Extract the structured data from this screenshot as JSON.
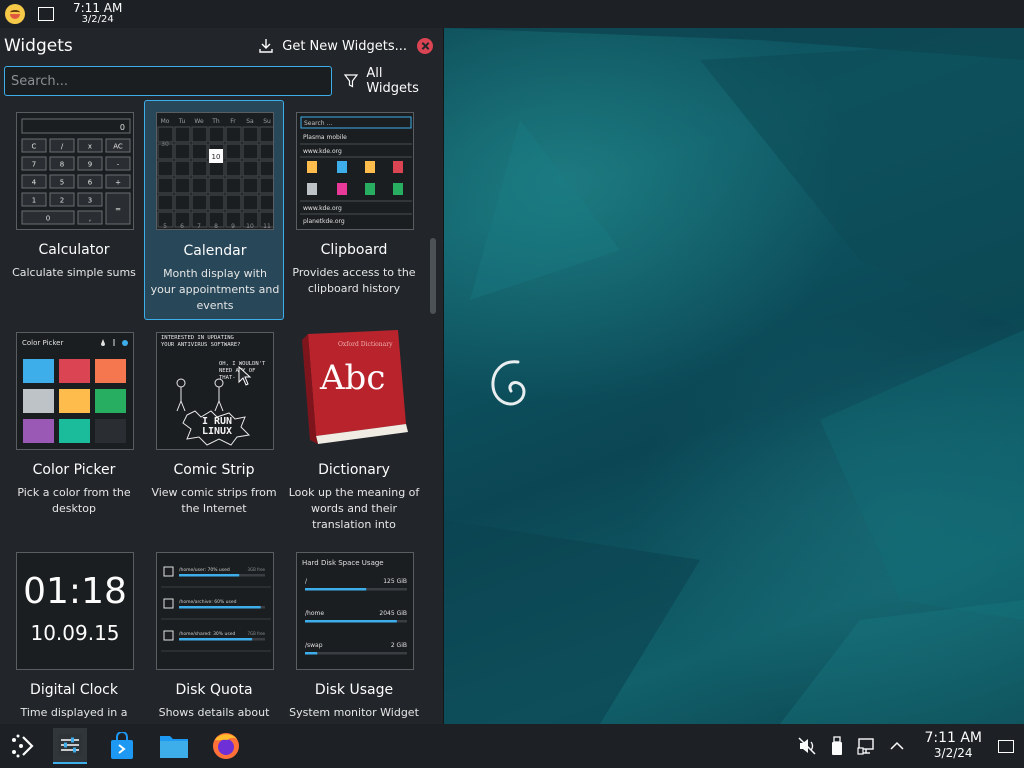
{
  "top_panel": {
    "clock_time": "7:11 AM",
    "clock_date": "3/2/24"
  },
  "widgets_panel": {
    "title": "Widgets",
    "get_new_label": "Get New Widgets...",
    "search_placeholder": "Search...",
    "filter_label": "All Widgets",
    "widgets": [
      {
        "name": "Calculator",
        "description": "Calculate simple sums"
      },
      {
        "name": "Calendar",
        "description": "Month display with your appointments and events"
      },
      {
        "name": "Clipboard",
        "description": "Provides access to the clipboard history"
      },
      {
        "name": "Color Picker",
        "description": "Pick a color from the desktop"
      },
      {
        "name": "Comic Strip",
        "description": "View comic strips from the Internet"
      },
      {
        "name": "Dictionary",
        "description": "Look up the meaning of words and their translation into differe..."
      },
      {
        "name": "Digital Clock",
        "description": "Time displayed in a"
      },
      {
        "name": "Disk Quota",
        "description": "Shows details about disk"
      },
      {
        "name": "Disk Usage",
        "description": "System monitor Widget"
      }
    ],
    "thumbs": {
      "calc_display": "0",
      "calc_keys": [
        "C",
        "/",
        "x",
        "AC",
        "7",
        "8",
        "9",
        "-",
        "4",
        "5",
        "6",
        "+",
        "1",
        "2",
        "3",
        "=",
        "0",
        ","
      ],
      "cal_headers": [
        "Mo",
        "Tu",
        "We",
        "Th",
        "Fr",
        "Sa",
        "Su"
      ],
      "cal_today": "10",
      "cal_first": "30",
      "cal_last_row": [
        "5",
        "6",
        "7",
        "8",
        "9",
        "10",
        "11"
      ],
      "clip_search": "Search ...",
      "clip_items": [
        "Plasma mobile",
        "www.kde.org",
        "www.kde.org",
        "planetkde.org"
      ],
      "picker_title": "Color Picker",
      "picker_colors": [
        "#3daee9",
        "#da4453",
        "#f47750",
        "#bdc3c7",
        "#fdbc4b",
        "#27ae60",
        "#9b59b6",
        "#1abc9c",
        "#2a2e32"
      ],
      "comic_bubble1": "INTERESTED IN UPDATING YOUR ANTIVIRUS SOFTWARE?",
      "comic_bubble2": "OH, I WOULDN'T NEED ANY OF THAT-",
      "comic_shout": "I RUN LINUX",
      "dict_book_title": "Abc",
      "dict_book_sub": "Oxford Dictionary",
      "clock_time": "01:18",
      "clock_date": "10.09.15",
      "quota_rows": [
        {
          "path": "/home/user: 70% used",
          "size": "3GB free",
          "pct": 0.7
        },
        {
          "path": "/home/archive: 60% used",
          "size": "",
          "pct": 0.95
        },
        {
          "path": "/home/shared: 30% used",
          "size": "7GB free",
          "pct": 0.85
        }
      ],
      "disk_title": "Hard Disk Space Usage",
      "disk_rows": [
        {
          "path": "/",
          "size": "125 GiB",
          "pct": 0.6
        },
        {
          "path": "/home",
          "size": "2045 GiB",
          "pct": 0.9
        },
        {
          "path": "/swap",
          "size": "2 GiB",
          "pct": 0.12
        }
      ]
    }
  },
  "taskbar": {
    "clock_time": "7:11 AM",
    "clock_date": "3/2/24"
  },
  "colors": {
    "accent": "#3daee9",
    "panel_bg": "#22262b",
    "close": "#da4453"
  }
}
